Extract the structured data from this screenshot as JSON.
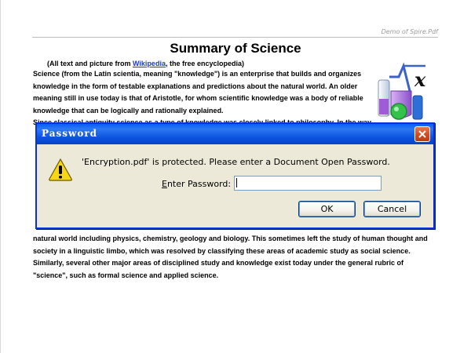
{
  "document": {
    "watermark": "Demo of Spire.Pdf",
    "title": "Summary of Science",
    "attribution_prefix": "(All text and picture from ",
    "attribution_link": "Wikipedia",
    "attribution_suffix": ", the free encyclopedia)",
    "paragraph_top": [
      "Science (from the Latin scientia, meaning \"knowledge\") is an enterprise that builds and organizes",
      "knowledge in the form of testable explanations and predictions about the natural world. An older",
      "meaning still in use today is that of Aristotle, for whom scientific knowledge was a body of reliable",
      "knowledge that can be logically and rationally explained."
    ],
    "partial_line": "Since classical antiquity science as a type of knowledge was closely linked to philosophy. In the way",
    "paragraph_bottom": [
      "natural world including physics, chemistry, geology and biology. This sometimes left the study of human thought and",
      "society in a linguistic limbo, which was resolved by classifying these areas of academic study as social science.",
      "Similarly, several other major areas of disciplined study and knowledge exist today under the general rubric of",
      "\"science\", such as formal science and applied science."
    ]
  },
  "dialog": {
    "title": "Password",
    "message": "'Encryption.pdf' is protected. Please enter a Document Open Password.",
    "label_mnemonic": "E",
    "label_rest": "nter Password:",
    "password_value": "",
    "ok_label": "OK",
    "cancel_label": "Cancel",
    "icons": {
      "warning": "warning-icon",
      "close": "close-icon"
    },
    "colors": {
      "titlebar": "#0a50dd",
      "close_button": "#d3471e",
      "dialog_bg": "#ece9d8"
    }
  }
}
